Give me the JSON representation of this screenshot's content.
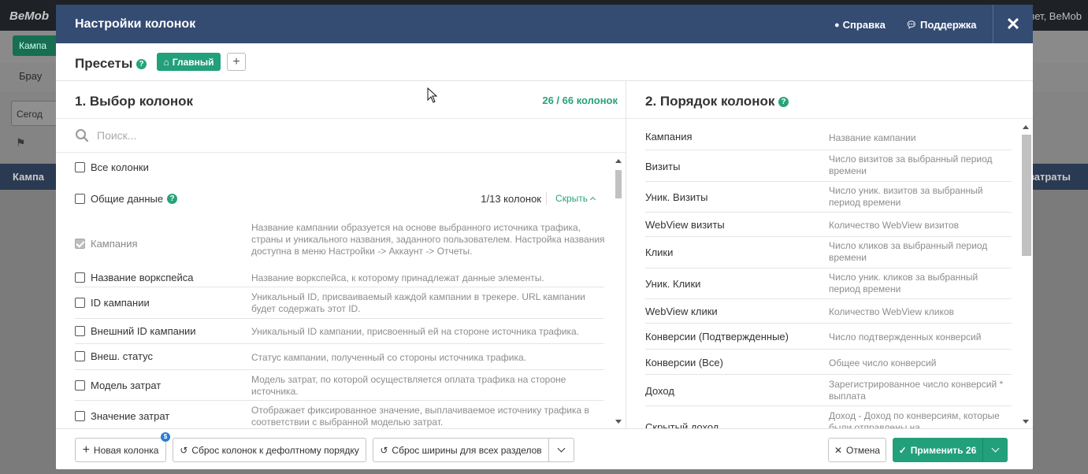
{
  "background": {
    "logo": "BeMob",
    "user": "вет, BeMob",
    "active_tab": "Кампа",
    "browser_label": "Брау",
    "date_label": "Сегод",
    "table_head_left": "Кампа",
    "table_head_right": "затраты"
  },
  "modal": {
    "title": "Настройки колонок",
    "help_label": "Справка",
    "support_label": "Поддержка",
    "close_label": "✕"
  },
  "presets": {
    "title": "Пресеты",
    "main_label": "Главный",
    "add_label": "+"
  },
  "left": {
    "title": "1. Выбор колонок",
    "count": "26 / 66 колонок",
    "search_placeholder": "Поиск...",
    "all_columns": "Все колонки",
    "group": {
      "label": "Общие данные",
      "count": "1/13 колонок",
      "hide": "Скрыть"
    },
    "items": [
      {
        "name": "Кампания",
        "desc": "Название кампании образуется на основе выбранного источника трафика, страны и уникального названия, заданного пользователем. Настройка названия доступна в меню Настройки -> Аккаунт -> Отчеты.",
        "checked": true
      },
      {
        "name": "Название воркспейса",
        "desc": "Название воркспейса, к которому принадлежат данные элементы.",
        "checked": false
      },
      {
        "name": "ID кампании",
        "desc": "Уникальный ID, присваиваемый каждой кампании в трекере. URL кампании будет содержать этот ID.",
        "checked": false
      },
      {
        "name": "Внешний ID кампании",
        "desc": "Уникальный ID кампании, присвоенный ей на стороне источника трафика.",
        "checked": false
      },
      {
        "name": "Внеш. статус",
        "desc": "Статус кампании, полученный со стороны источника трафика.",
        "checked": false
      },
      {
        "name": "Модель затрат",
        "desc": "Модель затрат, по которой осуществляется оплата трафика на стороне источника.",
        "checked": false
      },
      {
        "name": "Значение затрат",
        "desc": "Отображает фиксированное значение, выплачиваемое источнику трафика в соответствии с выбранной моделью затрат.",
        "checked": false
      }
    ]
  },
  "right": {
    "title": "2. Порядок колонок",
    "items": [
      {
        "name": "Кампания",
        "desc": "Название кампании"
      },
      {
        "name": "Визиты",
        "desc": "Число визитов за выбранный период времени"
      },
      {
        "name": "Уник. Визиты",
        "desc": "Число уник. визитов за выбранный период времени"
      },
      {
        "name": "WebView визиты",
        "desc": "Количество WebView визитов"
      },
      {
        "name": "Клики",
        "desc": "Число кликов за выбранный период времени"
      },
      {
        "name": "Уник. Клики",
        "desc": "Число уник. кликов за выбранный период времени"
      },
      {
        "name": "WebView клики",
        "desc": "Количество WebView кликов"
      },
      {
        "name": "Конверсии (Подтвержденные)",
        "desc": "Число подтвержденных конверсий"
      },
      {
        "name": "Конверсии (Все)",
        "desc": "Общее число конверсий"
      },
      {
        "name": "Доход",
        "desc": "Зарегистрированное число конверсий * выплата"
      },
      {
        "name": "Скрытый доход",
        "desc": "Доход - Доход по конверсиям, которые были отправлены на"
      }
    ]
  },
  "footer": {
    "new_column": "Новая колонка",
    "new_badge": "$",
    "reset_order": "Сброс колонок к дефолтному порядку",
    "reset_width": "Сброс ширины для всех разделов",
    "cancel": "Отмена",
    "apply": "Применить 26"
  },
  "colors": {
    "header_bg": "#344b72",
    "accent": "#22a07b",
    "badge_blue": "#2d7bd4"
  }
}
